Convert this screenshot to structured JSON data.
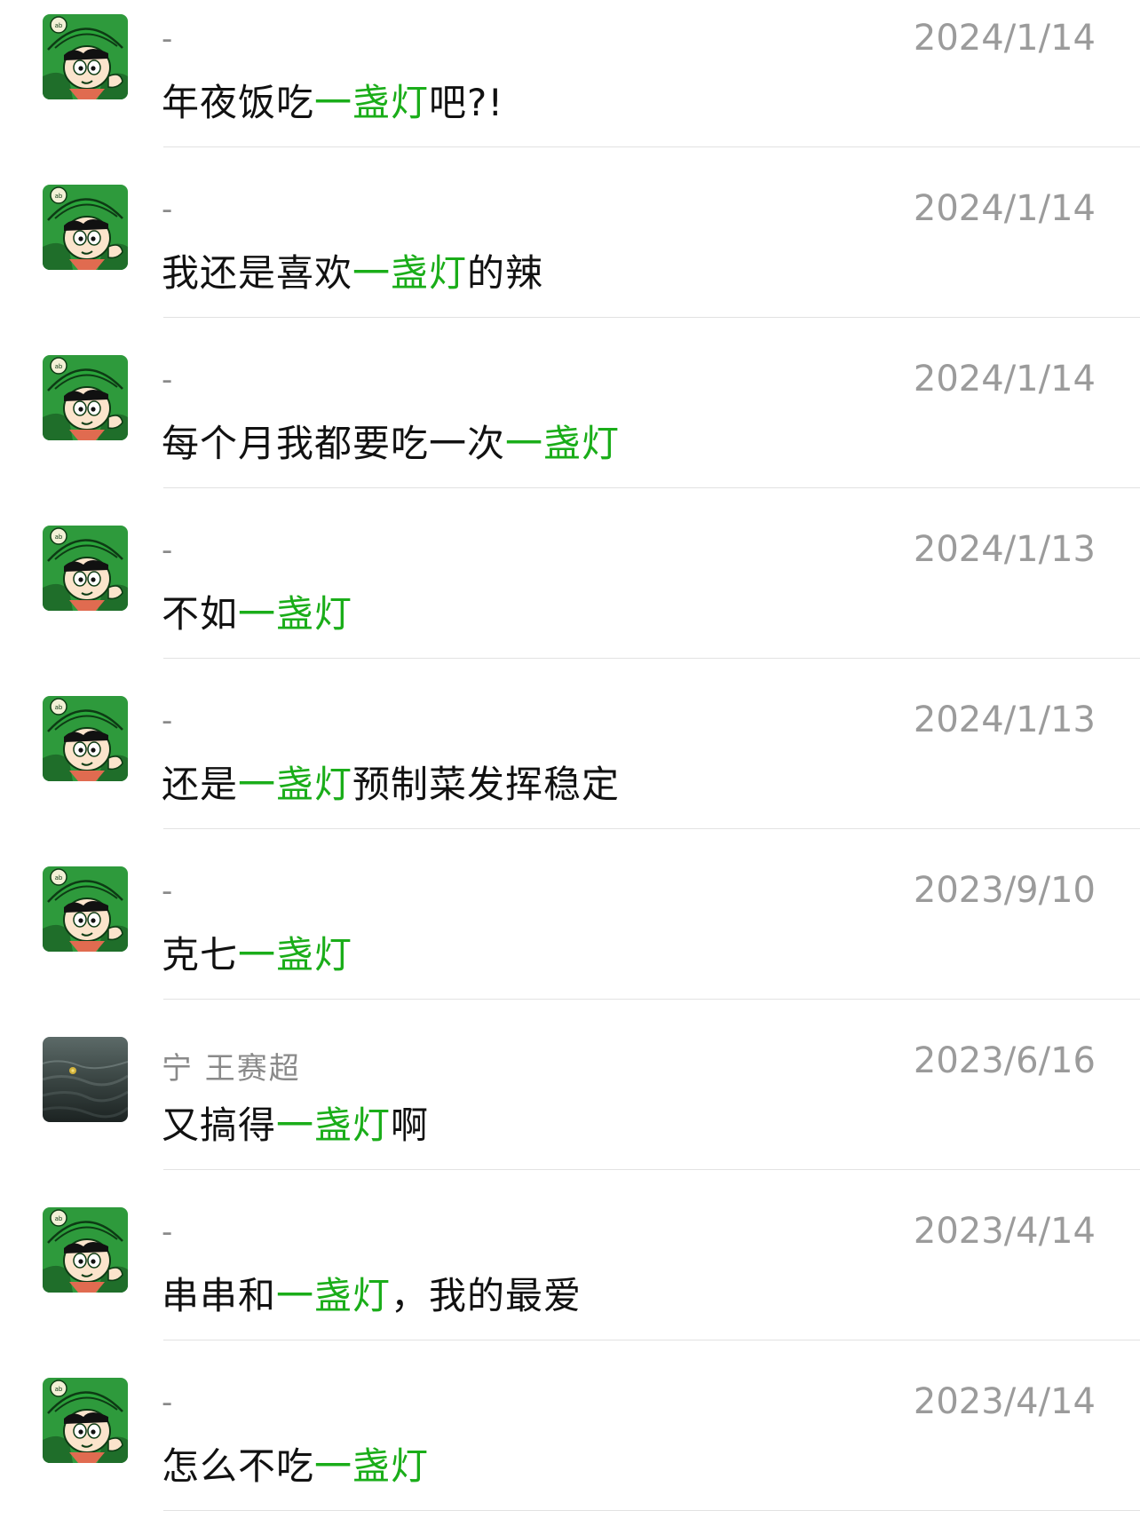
{
  "messages": [
    {
      "name": "-",
      "date": "2024/1/14",
      "pre": "年夜饭吃",
      "hl": "一盏灯",
      "post": "吧?!",
      "avatar": "cartoon-avatar"
    },
    {
      "name": "-",
      "date": "2024/1/14",
      "pre": "我还是喜欢",
      "hl": "一盏灯",
      "post": "的辣",
      "avatar": "cartoon-avatar"
    },
    {
      "name": "-",
      "date": "2024/1/14",
      "pre": "每个月我都要吃一次",
      "hl": "一盏灯",
      "post": "",
      "avatar": "cartoon-avatar"
    },
    {
      "name": "-",
      "date": "2024/1/13",
      "pre": "不如",
      "hl": "一盏灯",
      "post": "",
      "avatar": "cartoon-avatar"
    },
    {
      "name": "-",
      "date": "2024/1/13",
      "pre": "还是",
      "hl": "一盏灯",
      "post": "预制菜发挥稳定",
      "avatar": "cartoon-avatar"
    },
    {
      "name": "-",
      "date": "2023/9/10",
      "pre": "克七",
      "hl": "一盏灯",
      "post": "",
      "avatar": "cartoon-avatar"
    },
    {
      "name": "宁  王赛超",
      "date": "2023/6/16",
      "pre": "又搞得",
      "hl": "一盏灯",
      "post": "啊",
      "avatar": "water-photo-avatar"
    },
    {
      "name": "-",
      "date": "2023/4/14",
      "pre": "串串和",
      "hl": "一盏灯",
      "post": "，我的最爱",
      "avatar": "cartoon-avatar"
    },
    {
      "name": "-",
      "date": "2023/4/14",
      "pre": "怎么不吃",
      "hl": "一盏灯",
      "post": "",
      "avatar": "cartoon-avatar"
    }
  ],
  "colors": {
    "highlight": "#1aad19",
    "date": "#9b9b9b",
    "name": "#8a8a8a",
    "divider": "#e2e2e2"
  }
}
